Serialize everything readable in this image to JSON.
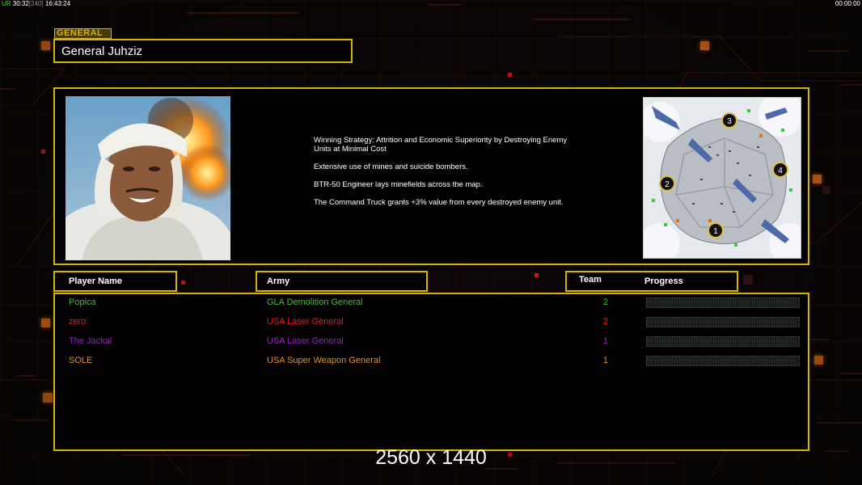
{
  "status_bar": {
    "prefix": "UR",
    "counter": "30",
    "counter2": "32",
    "bracket": "[240]",
    "clock": "16:43:24",
    "timer": "00:00:00"
  },
  "general": {
    "tag": "GENERAL",
    "name": "General Juhziz",
    "description": [
      "Winning Strategy: Attrition and Economic Superiority by Destroying Enemy Units at Minimal Cost",
      "Extensive use of mines and suicide bombers.",
      "BTR-50 Engineer lays minefields across the map.",
      "The Command Truck grants +3% value from every destroyed enemy unit."
    ]
  },
  "minimap": {
    "start_positions": [
      "1",
      "2",
      "3",
      "4"
    ]
  },
  "columns": {
    "player_name": "Player Name",
    "army": "Army",
    "team": "Team",
    "progress": "Progress"
  },
  "players": [
    {
      "name": "Popica",
      "army": "GLA Demolition General",
      "team": "2",
      "color": "#3fbf2f",
      "progress": 0
    },
    {
      "name": "zero",
      "army": "USA Laser General",
      "team": "2",
      "color": "#e81c1c",
      "progress": 0
    },
    {
      "name": "The Jackal",
      "army": "USA Laser General",
      "team": "1",
      "color": "#9a20c8",
      "progress": 0
    },
    {
      "name": "SOLE",
      "army": "USA Super Weapon General",
      "team": "1",
      "color": "#e0902a",
      "progress": 0
    }
  ],
  "overlay": {
    "resolution": "2560 x 1440"
  },
  "colors": {
    "accent_gold": "#d8b400",
    "accent_orange": "#ff7a1a"
  }
}
